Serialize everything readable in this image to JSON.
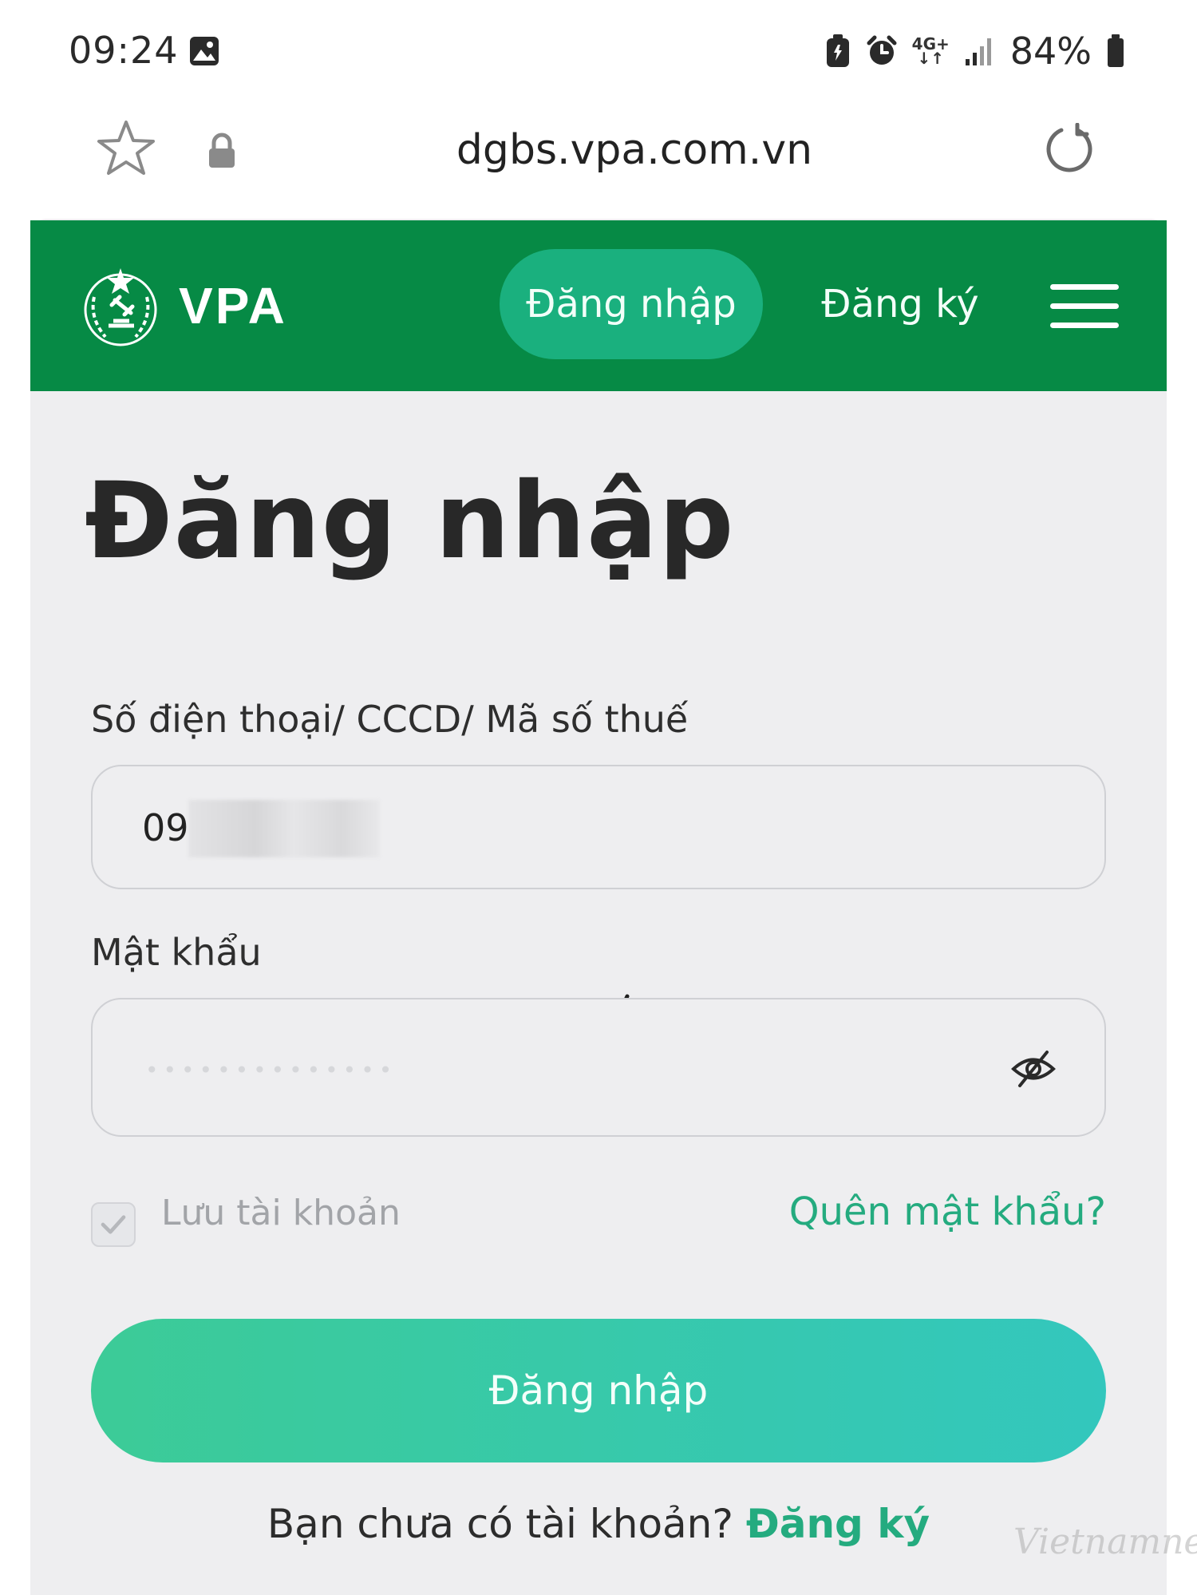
{
  "status_bar": {
    "time": "09:24",
    "network": "4G+",
    "battery": "84%",
    "icons": [
      "gallery-icon",
      "battery-saver-icon",
      "alarm-icon",
      "network-icon",
      "signal-icon",
      "battery-icon"
    ]
  },
  "browser": {
    "url": "dgbs.vpa.com.vn",
    "icons": [
      "star-icon",
      "lock-icon",
      "reload-icon"
    ]
  },
  "header": {
    "brand": "VPA",
    "nav_login": "Đăng nhập",
    "nav_register": "Đăng ký",
    "colors": {
      "background": "#068a45",
      "active_pill": "#1ab07e"
    }
  },
  "login_form": {
    "title": "Đăng nhập",
    "phone_label": "Số điện thoại/ CCCD/ Mã số thuế",
    "phone_value": "09",
    "password_label": "Mật khẩu",
    "password_mask": "••••••••••••••",
    "remember_label": "Lưu tài khoản",
    "remember_checked": true,
    "forgot_link": "Quên mật khẩu?",
    "submit_label": "Đăng nhập",
    "no_account_text": "Bạn chưa có tài khoản?",
    "signup_link": "Đăng ký",
    "colors": {
      "accent": "#24ab7f",
      "button_start": "#3ccb97",
      "button_end": "#33c7bd"
    }
  },
  "watermark": "Vietnamnet"
}
